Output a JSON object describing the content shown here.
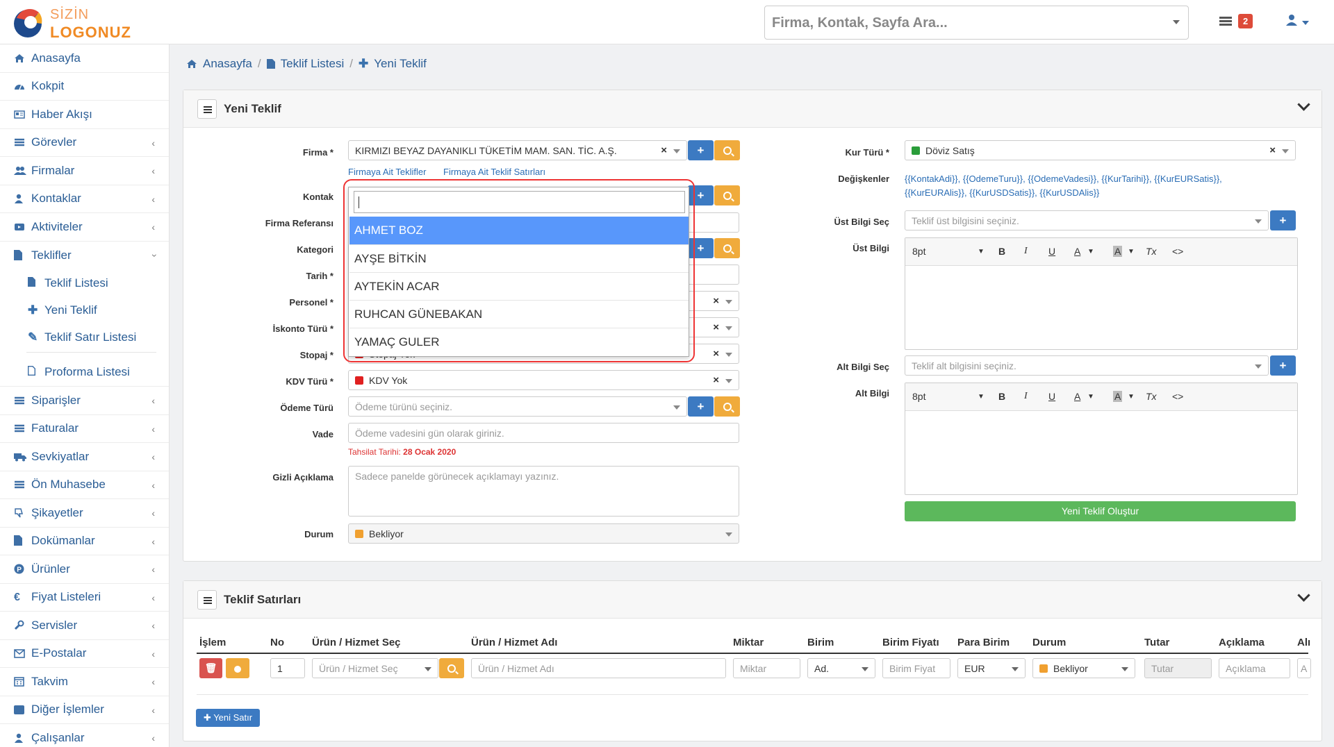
{
  "header": {
    "logo_line1": "SİZİN",
    "logo_line2": "LOGONUZ",
    "search_placeholder": "Firma, Kontak, Sayfa Ara...",
    "notification_count": "2"
  },
  "sidebar": {
    "items": [
      {
        "label": "Anasayfa",
        "icon": "home-icon"
      },
      {
        "label": "Kokpit",
        "icon": "dashboard-icon"
      },
      {
        "label": "Haber Akışı",
        "icon": "news-icon"
      },
      {
        "label": "Görevler",
        "icon": "tasks-icon"
      },
      {
        "label": "Firmalar",
        "icon": "users-icon"
      },
      {
        "label": "Kontaklar",
        "icon": "user-icon"
      },
      {
        "label": "Aktiviteler",
        "icon": "video-icon"
      },
      {
        "label": "Teklifler",
        "icon": "file-icon"
      }
    ],
    "sub_items": [
      {
        "label": "Teklif Listesi",
        "icon": "file-icon"
      },
      {
        "label": "Yeni Teklif",
        "icon": "plus-icon"
      },
      {
        "label": "Teklif Satır Listesi",
        "icon": "pencil-icon"
      },
      {
        "label": "Proforma Listesi",
        "icon": "file-outline-icon"
      }
    ],
    "items2": [
      {
        "label": "Siparişler",
        "icon": "list-icon"
      },
      {
        "label": "Faturalar",
        "icon": "list-icon"
      },
      {
        "label": "Sevkiyatlar",
        "icon": "truck-icon"
      },
      {
        "label": "Ön Muhasebe",
        "icon": "list-icon"
      },
      {
        "label": "Şikayetler",
        "icon": "thumbs-down-icon"
      },
      {
        "label": "Dokümanlar",
        "icon": "document-icon"
      },
      {
        "label": "Ürünler",
        "icon": "product-icon"
      },
      {
        "label": "Fiyat Listeleri",
        "icon": "euro-icon"
      },
      {
        "label": "Servisler",
        "icon": "wrench-icon"
      },
      {
        "label": "E-Postalar",
        "icon": "envelope-icon"
      },
      {
        "label": "Takvim",
        "icon": "calendar-icon"
      },
      {
        "label": "Diğer İşlemler",
        "icon": "square-icon"
      },
      {
        "label": "Çalışanlar",
        "icon": "user-icon"
      }
    ]
  },
  "breadcrumb": [
    "Anasayfa",
    "Teklif Listesi",
    "Yeni Teklif"
  ],
  "form_panel": {
    "title": "Yeni Teklif",
    "labels": {
      "firma": "Firma *",
      "kontak": "Kontak",
      "firma_ref": "Firma Referansı",
      "kategori": "Kategori",
      "tarih": "Tarih *",
      "personel": "Personel *",
      "iskonto": "İskonto Türü *",
      "stopaj": "Stopaj *",
      "kdv": "KDV Türü *",
      "odeme": "Ödeme Türü",
      "vade": "Vade",
      "gizli": "Gizli Açıklama",
      "durum": "Durum",
      "kur": "Kur Türü *",
      "degiskenler": "Değişkenler",
      "ust_sec": "Üst Bilgi Seç",
      "ust_bilgi": "Üst Bilgi",
      "alt_sec": "Alt Bilgi Seç",
      "alt_bilgi": "Alt Bilgi"
    },
    "firma_value": "KIRMIZI BEYAZ DAYANIKLI TÜKETİM MAM. SAN. TİC. A.Ş.",
    "firma_link1": "Firmaya Ait Teklifler",
    "firma_link2": "Firmaya Ait Teklif Satırları",
    "stopaj_partial": "Stopaj Yok",
    "kdv_value": "KDV Yok",
    "kdv_color": "#e02020",
    "odeme_placeholder": "Ödeme türünü seçiniz.",
    "vade_placeholder": "Ödeme vadesini gün olarak giriniz.",
    "tahsilat_label": "Tahsilat Tarihi:",
    "tahsilat_date": "28 Ocak 2020",
    "gizli_placeholder": "Sadece panelde görünecek açıklamayı yazınız.",
    "durum_value": "Bekliyor",
    "durum_color": "#f0a030",
    "kur_value": "Döviz Satış",
    "kur_color": "#2a9d3a",
    "degiskenler_line1": "{{KontakAdi}}, {{OdemeTuru}}, {{OdemeVadesi}}, {{KurTarihi}}, {{KurEURSatis}},",
    "degiskenler_line2": "{{KurEURAlis}}, {{KurUSDSatis}}, {{KurUSDAlis}}",
    "ust_placeholder": "Teklif üst bilgisini seçiniz.",
    "alt_placeholder": "Teklif alt bilgisini seçiniz.",
    "editor_font_size": "8pt",
    "submit_label": "Yeni Teklif Oluştur"
  },
  "kontak_dropdown": {
    "search_value": "",
    "options": [
      "AHMET BOZ",
      "AYŞE BİTKİN",
      "AYTEKİN ACAR",
      "RUHCAN GÜNEBAKAN",
      "YAMAÇ GULER"
    ],
    "selected_index": 0
  },
  "lines_panel": {
    "title": "Teklif Satırları",
    "columns": [
      "İşlem",
      "No",
      "Ürün / Hizmet Seç",
      "Ürün / Hizmet Adı",
      "Miktar",
      "Birim",
      "Birim Fiyatı",
      "Para Birim",
      "Durum",
      "Tutar",
      "Açıklama",
      "Alı"
    ],
    "row": {
      "no": "1",
      "urun_sec_placeholder": "Ürün / Hizmet Seç",
      "urun_adi_placeholder": "Ürün / Hizmet Adı",
      "miktar_placeholder": "Miktar",
      "birim": "Ad.",
      "birim_fiyat_placeholder": "Birim Fiyat",
      "para_birim": "EUR",
      "durum": "Bekliyor",
      "tutar_placeholder": "Tutar",
      "aciklama_placeholder": "Açıklama",
      "last_partial": "A"
    },
    "add_row_label": "Yeni Satır"
  }
}
